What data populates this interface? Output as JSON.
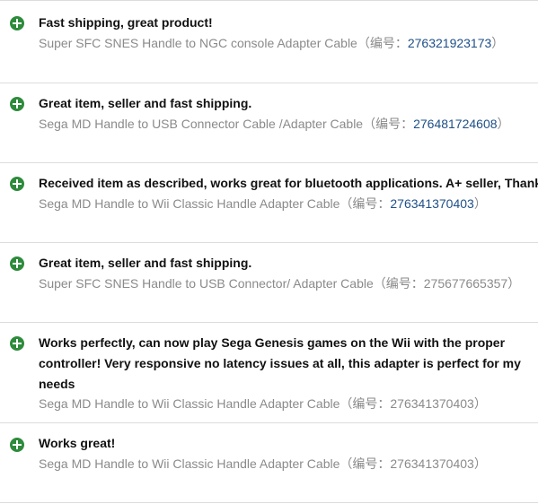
{
  "reviews": [
    {
      "comment": "Fast shipping, great product!",
      "product": "Super SFC SNES Handle to NGC console Adapter Cable",
      "id_prefix": "（编号：",
      "item_id": "276321923173",
      "id_suffix": "）"
    },
    {
      "comment": "Great item, seller and fast shipping.",
      "product": "Sega MD Handle to USB Connector Cable /Adapter Cable",
      "id_prefix": "（编号：",
      "item_id": "276481724608",
      "id_suffix": "）"
    },
    {
      "comment": "Received item as described, works great for bluetooth applications. A+ seller, Thank",
      "product": "Sega MD Handle to Wii Classic Handle Adapter Cable",
      "id_prefix": "（编号：",
      "item_id": "276341370403",
      "id_suffix": "）"
    },
    {
      "comment": "Great item, seller and fast shipping.",
      "product": "Super SFC SNES Handle to USB Connector/ Adapter Cable",
      "id_prefix": "（编号：",
      "item_id": "275677665357",
      "id_suffix": "）"
    },
    {
      "comment": "Works perfectly, can now play Sega Genesis games on the Wii with the proper controller! Very responsive no latency issues at all, this adapter is perfect for my needs",
      "product": "Sega MD Handle to Wii Classic Handle Adapter Cable",
      "id_prefix": "（编号：",
      "item_id": "276341370403",
      "id_suffix": "）"
    },
    {
      "comment": "Works great!",
      "product": "Sega MD Handle to Wii Classic Handle Adapter Cable",
      "id_prefix": "（编号：",
      "item_id": "276341370403",
      "id_suffix": "）"
    }
  ],
  "icons": {
    "positive": "plus-circle-icon"
  },
  "colors": {
    "positive": "#2e8b3c",
    "link": "#1e4f87",
    "muted": "#8a8a8a"
  }
}
